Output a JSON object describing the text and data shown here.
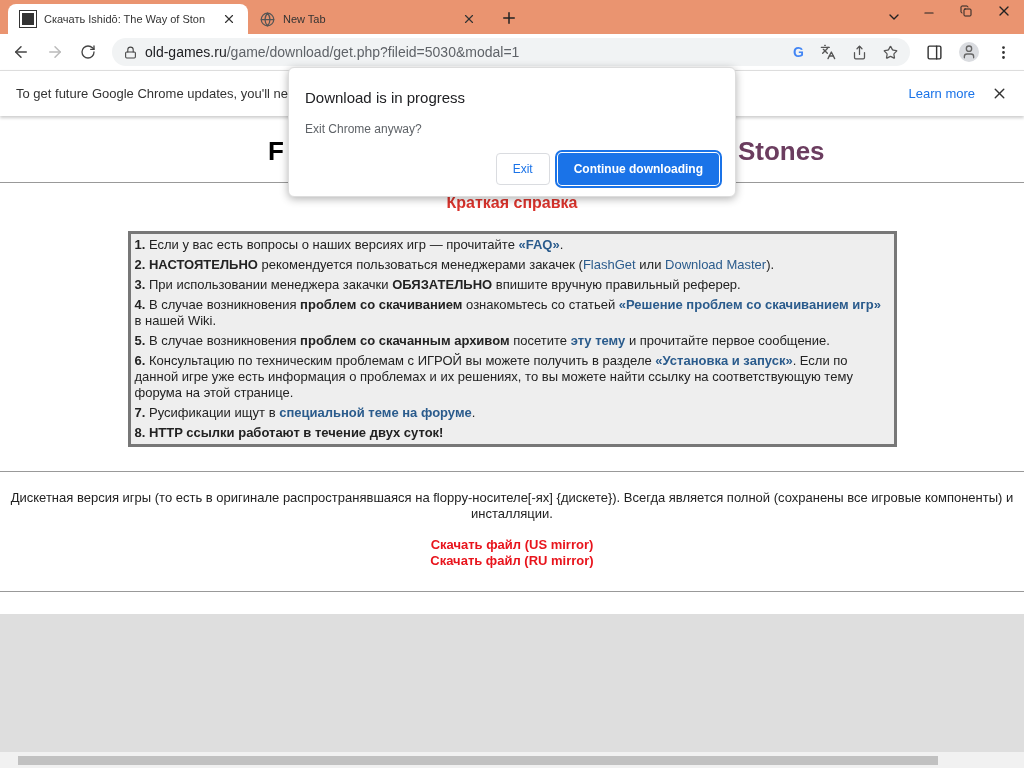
{
  "tabs": [
    {
      "title": "Скачать Ishidō: The Way of Ston",
      "selected": true
    },
    {
      "title": "New Tab",
      "selected": false
    }
  ],
  "address": {
    "host": "old-games.ru",
    "path": "/game/download/get.php?fileid=5030&modal=1",
    "badge": "G"
  },
  "infobar": {
    "text": "To get future Google Chrome updates, you'll ne",
    "link": "Learn more"
  },
  "dialog": {
    "title": "Download is in progress",
    "message": "Exit Chrome anyway?",
    "buttons": [
      {
        "label": "Exit",
        "kind": "secondary"
      },
      {
        "label": "Continue downloading",
        "kind": "primary"
      }
    ]
  },
  "page": {
    "heading_left": "F",
    "heading_right": "Stones",
    "help_title": "Краткая справка",
    "rules": [
      [
        {
          "text": "1.",
          "kind": "bold"
        },
        {
          "text": " Если у вас есть вопросы о наших версиях игр — прочитайте ",
          "kind": "plain"
        },
        {
          "text": "«FAQ»",
          "kind": "boldlink"
        },
        {
          "text": ".",
          "kind": "plain"
        }
      ],
      [
        {
          "text": "2. НАСТОЯТЕЛЬНО",
          "kind": "bold"
        },
        {
          "text": " рекомендуется пользоваться менеджерами закачек (",
          "kind": "plain"
        },
        {
          "text": "FlashGet",
          "kind": "link"
        },
        {
          "text": " или ",
          "kind": "plain"
        },
        {
          "text": "Download Master",
          "kind": "link"
        },
        {
          "text": ").",
          "kind": "plain"
        }
      ],
      [
        {
          "text": "3.",
          "kind": "bold"
        },
        {
          "text": " При использовании менеджера закачки ",
          "kind": "plain"
        },
        {
          "text": "ОБЯЗАТЕЛЬНО",
          "kind": "bold"
        },
        {
          "text": " впишите вручную правильный реферер.",
          "kind": "plain"
        }
      ],
      [
        {
          "text": "4.",
          "kind": "bold"
        },
        {
          "text": " В случае возникновения ",
          "kind": "plain"
        },
        {
          "text": "проблем со скачиванием",
          "kind": "bold"
        },
        {
          "text": " ознакомьтесь со статьей ",
          "kind": "plain"
        },
        {
          "text": "«Решение проблем со скачиванием игр»",
          "kind": "boldlink"
        },
        {
          "text": " в нашей Wiki.",
          "kind": "plain"
        }
      ],
      [
        {
          "text": "5.",
          "kind": "bold"
        },
        {
          "text": " В случае возникновения ",
          "kind": "plain"
        },
        {
          "text": "проблем со скачанным архивом",
          "kind": "bold"
        },
        {
          "text": " посетите ",
          "kind": "plain"
        },
        {
          "text": "эту тему",
          "kind": "boldlink"
        },
        {
          "text": " и прочитайте первое сообщение.",
          "kind": "plain"
        }
      ],
      [
        {
          "text": "6.",
          "kind": "bold"
        },
        {
          "text": " Консультацию по техническим проблемам с ИГРОЙ вы можете получить в разделе ",
          "kind": "plain"
        },
        {
          "text": "«Установка и запуск»",
          "kind": "boldlink"
        },
        {
          "text": ". Если по данной игре уже есть информация о проблемах и их решениях, то вы можете найти ссылку на соответствующую тему форума на этой странице.",
          "kind": "plain"
        }
      ],
      [
        {
          "text": "7.",
          "kind": "bold"
        },
        {
          "text": " Русификации ищут в ",
          "kind": "plain"
        },
        {
          "text": "специальной теме на форуме",
          "kind": "boldlink"
        },
        {
          "text": ".",
          "kind": "plain"
        }
      ],
      [
        {
          "text": "8. HTTP ссылки работают в течение двух суток!",
          "kind": "bold"
        }
      ]
    ],
    "description": "Дискетная версия игры (то есть в оригинале распространявшаяся на floppy-носителе[-ях] {дискете}). Всегда является полной (сохранены все игровые компоненты) и инсталляции.",
    "downloads": [
      "Скачать файл (US mirror)",
      "Скачать файл (RU mirror)"
    ]
  }
}
